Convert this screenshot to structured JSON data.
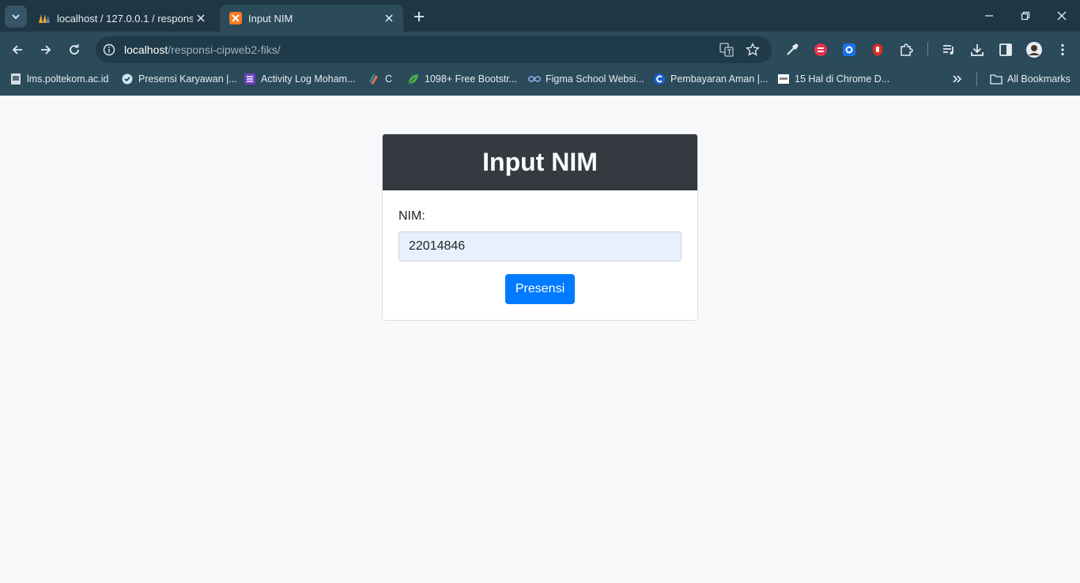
{
  "browser": {
    "tabs": [
      {
        "title": "localhost / 127.0.0.1 / responsi_",
        "favicon": "phpmyadmin-icon",
        "active": false
      },
      {
        "title": "Input NIM",
        "favicon": "xampp-icon",
        "active": true
      }
    ],
    "address": {
      "host": "localhost",
      "path": "/responsi-cipweb2-fiks/"
    },
    "bookmarks": [
      {
        "label": "lms.poltekom.ac.id",
        "icon": "page-icon"
      },
      {
        "label": "Presensi Karyawan |...",
        "icon": "check-circle-icon"
      },
      {
        "label": "Activity Log Moham...",
        "icon": "list-icon"
      },
      {
        "label": "C",
        "icon": "pen-icon"
      },
      {
        "label": "1098+ Free Bootstr...",
        "icon": "leaf-icon"
      },
      {
        "label": "Figma School Websi...",
        "icon": "infinity-icon"
      },
      {
        "label": "Pembayaran Aman |...",
        "icon": "c-logo-icon"
      },
      {
        "label": "15 Hal di Chrome D...",
        "icon": "page-icon"
      }
    ],
    "all_bookmarks_label": "All Bookmarks"
  },
  "page": {
    "header_title": "Input NIM",
    "nim_label": "NIM:",
    "nim_value": "22014846",
    "submit_label": "Presensi"
  },
  "colors": {
    "card_header": "#343a40",
    "primary_button": "#007bff",
    "autofill_background": "#e8f0fe",
    "page_background": "#f8f9fa"
  }
}
